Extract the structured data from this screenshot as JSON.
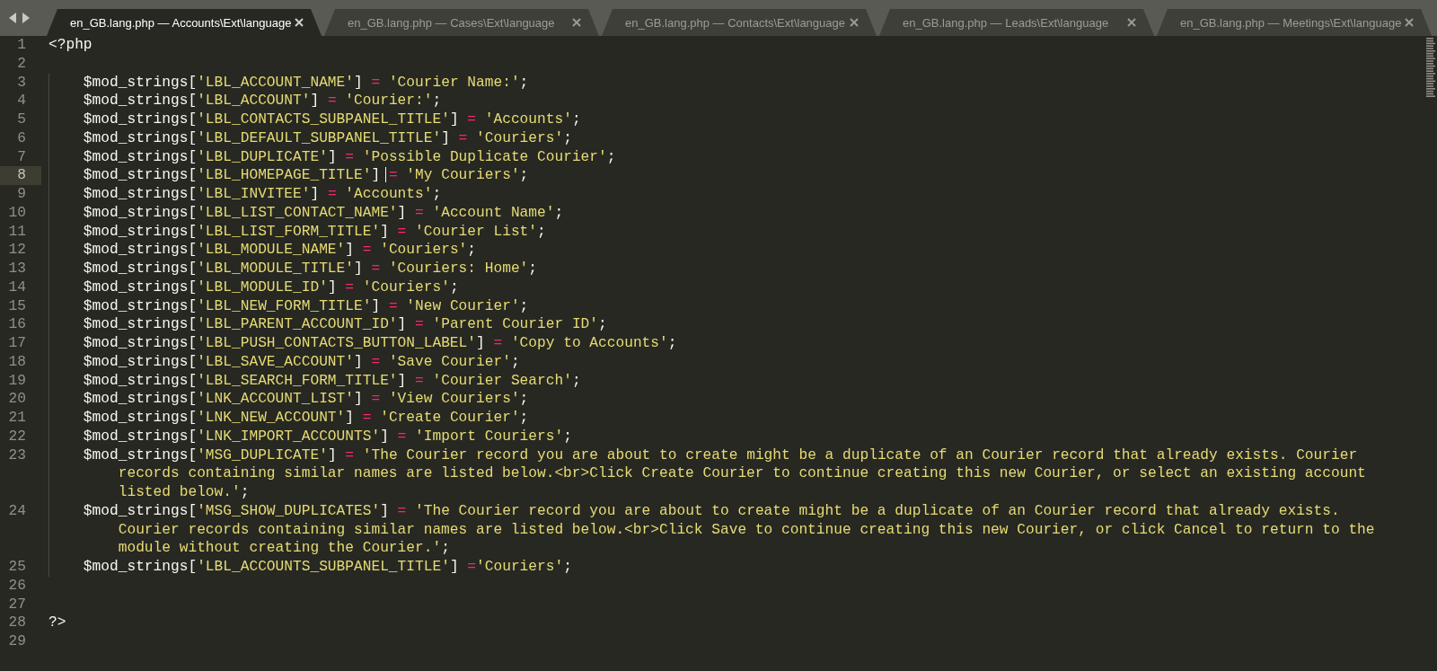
{
  "tabs": [
    {
      "label": "en_GB.lang.php — Accounts\\Ext\\language",
      "selected": true
    },
    {
      "label": "en_GB.lang.php — Cases\\Ext\\language",
      "selected": false
    },
    {
      "label": "en_GB.lang.php — Contacts\\Ext\\language",
      "selected": false
    },
    {
      "label": "en_GB.lang.php — Leads\\Ext\\language",
      "selected": false
    },
    {
      "label": "en_GB.lang.php — Meetings\\Ext\\language",
      "selected": false
    }
  ],
  "lines": [
    {
      "number": "1",
      "current": false,
      "indented": false,
      "tokens": [
        {
          "kind": "plain",
          "text": "<?php"
        }
      ]
    },
    {
      "number": "2",
      "current": false
    },
    {
      "number": "3",
      "current": false,
      "indented": true,
      "tokens": [
        {
          "kind": "plain",
          "text": "$mod_strings["
        },
        {
          "kind": "string",
          "text": "'LBL_ACCOUNT_NAME'"
        },
        {
          "kind": "plain",
          "text": "] "
        },
        {
          "kind": "op",
          "text": "="
        },
        {
          "kind": "string",
          "text": " 'Courier Name:'"
        },
        {
          "kind": "plain",
          "text": ";"
        }
      ]
    },
    {
      "number": "4",
      "current": false,
      "indented": true,
      "tokens": [
        {
          "kind": "plain",
          "text": "$mod_strings["
        },
        {
          "kind": "string",
          "text": "'LBL_ACCOUNT'"
        },
        {
          "kind": "plain",
          "text": "] "
        },
        {
          "kind": "op",
          "text": "="
        },
        {
          "kind": "string",
          "text": " 'Courier:'"
        },
        {
          "kind": "plain",
          "text": ";"
        }
      ]
    },
    {
      "number": "5",
      "current": false,
      "indented": true,
      "tokens": [
        {
          "kind": "plain",
          "text": "$mod_strings["
        },
        {
          "kind": "string",
          "text": "'LBL_CONTACTS_SUBPANEL_TITLE'"
        },
        {
          "kind": "plain",
          "text": "] "
        },
        {
          "kind": "op",
          "text": "="
        },
        {
          "kind": "string",
          "text": " 'Accounts'"
        },
        {
          "kind": "plain",
          "text": ";"
        }
      ]
    },
    {
      "number": "6",
      "current": false,
      "indented": true,
      "tokens": [
        {
          "kind": "plain",
          "text": "$mod_strings["
        },
        {
          "kind": "string",
          "text": "'LBL_DEFAULT_SUBPANEL_TITLE'"
        },
        {
          "kind": "plain",
          "text": "] "
        },
        {
          "kind": "op",
          "text": "="
        },
        {
          "kind": "string",
          "text": " 'Couriers'"
        },
        {
          "kind": "plain",
          "text": ";"
        }
      ]
    },
    {
      "number": "7",
      "current": false,
      "indented": true,
      "tokens": [
        {
          "kind": "plain",
          "text": "$mod_strings["
        },
        {
          "kind": "string",
          "text": "'LBL_DUPLICATE'"
        },
        {
          "kind": "plain",
          "text": "] "
        },
        {
          "kind": "op",
          "text": "="
        },
        {
          "kind": "string",
          "text": " 'Possible Duplicate Courier'"
        },
        {
          "kind": "plain",
          "text": ";"
        }
      ]
    },
    {
      "number": "8",
      "current": true,
      "indented": true,
      "tokens": [
        {
          "kind": "plain",
          "text": "$mod_strings["
        },
        {
          "kind": "string",
          "text": "'LBL_HOMEPAGE_TITLE'"
        },
        {
          "kind": "plain",
          "text": "] ",
          "caret": true
        },
        {
          "kind": "op",
          "text": "="
        },
        {
          "kind": "string",
          "text": " 'My Couriers'"
        },
        {
          "kind": "plain",
          "text": ";"
        }
      ]
    },
    {
      "number": "9",
      "current": false,
      "indented": true,
      "tokens": [
        {
          "kind": "plain",
          "text": "$mod_strings["
        },
        {
          "kind": "string",
          "text": "'LBL_INVITEE'"
        },
        {
          "kind": "plain",
          "text": "] "
        },
        {
          "kind": "op",
          "text": "="
        },
        {
          "kind": "string",
          "text": " 'Accounts'"
        },
        {
          "kind": "plain",
          "text": ";"
        }
      ]
    },
    {
      "number": "10",
      "current": false,
      "indented": true,
      "tokens": [
        {
          "kind": "plain",
          "text": "$mod_strings["
        },
        {
          "kind": "string",
          "text": "'LBL_LIST_CONTACT_NAME'"
        },
        {
          "kind": "plain",
          "text": "] "
        },
        {
          "kind": "op",
          "text": "="
        },
        {
          "kind": "string",
          "text": " 'Account Name'"
        },
        {
          "kind": "plain",
          "text": ";"
        }
      ]
    },
    {
      "number": "11",
      "current": false,
      "indented": true,
      "tokens": [
        {
          "kind": "plain",
          "text": "$mod_strings["
        },
        {
          "kind": "string",
          "text": "'LBL_LIST_FORM_TITLE'"
        },
        {
          "kind": "plain",
          "text": "] "
        },
        {
          "kind": "op",
          "text": "="
        },
        {
          "kind": "string",
          "text": " 'Courier List'"
        },
        {
          "kind": "plain",
          "text": ";"
        }
      ]
    },
    {
      "number": "12",
      "current": false,
      "indented": true,
      "tokens": [
        {
          "kind": "plain",
          "text": "$mod_strings["
        },
        {
          "kind": "string",
          "text": "'LBL_MODULE_NAME'"
        },
        {
          "kind": "plain",
          "text": "] "
        },
        {
          "kind": "op",
          "text": "="
        },
        {
          "kind": "string",
          "text": " 'Couriers'"
        },
        {
          "kind": "plain",
          "text": ";"
        }
      ]
    },
    {
      "number": "13",
      "current": false,
      "indented": true,
      "tokens": [
        {
          "kind": "plain",
          "text": "$mod_strings["
        },
        {
          "kind": "string",
          "text": "'LBL_MODULE_TITLE'"
        },
        {
          "kind": "plain",
          "text": "] "
        },
        {
          "kind": "op",
          "text": "="
        },
        {
          "kind": "string",
          "text": " 'Couriers: Home'"
        },
        {
          "kind": "plain",
          "text": ";"
        }
      ]
    },
    {
      "number": "14",
      "current": false,
      "indented": true,
      "tokens": [
        {
          "kind": "plain",
          "text": "$mod_strings["
        },
        {
          "kind": "string",
          "text": "'LBL_MODULE_ID'"
        },
        {
          "kind": "plain",
          "text": "] "
        },
        {
          "kind": "op",
          "text": "="
        },
        {
          "kind": "string",
          "text": " 'Couriers'"
        },
        {
          "kind": "plain",
          "text": ";"
        }
      ]
    },
    {
      "number": "15",
      "current": false,
      "indented": true,
      "tokens": [
        {
          "kind": "plain",
          "text": "$mod_strings["
        },
        {
          "kind": "string",
          "text": "'LBL_NEW_FORM_TITLE'"
        },
        {
          "kind": "plain",
          "text": "] "
        },
        {
          "kind": "op",
          "text": "="
        },
        {
          "kind": "string",
          "text": " 'New Courier'"
        },
        {
          "kind": "plain",
          "text": ";"
        }
      ]
    },
    {
      "number": "16",
      "current": false,
      "indented": true,
      "tokens": [
        {
          "kind": "plain",
          "text": "$mod_strings["
        },
        {
          "kind": "string",
          "text": "'LBL_PARENT_ACCOUNT_ID'"
        },
        {
          "kind": "plain",
          "text": "] "
        },
        {
          "kind": "op",
          "text": "="
        },
        {
          "kind": "string",
          "text": " 'Parent Courier ID'"
        },
        {
          "kind": "plain",
          "text": ";"
        }
      ]
    },
    {
      "number": "17",
      "current": false,
      "indented": true,
      "tokens": [
        {
          "kind": "plain",
          "text": "$mod_strings["
        },
        {
          "kind": "string",
          "text": "'LBL_PUSH_CONTACTS_BUTTON_LABEL'"
        },
        {
          "kind": "plain",
          "text": "] "
        },
        {
          "kind": "op",
          "text": "="
        },
        {
          "kind": "string",
          "text": " 'Copy to Accounts'"
        },
        {
          "kind": "plain",
          "text": ";"
        }
      ]
    },
    {
      "number": "18",
      "current": false,
      "indented": true,
      "tokens": [
        {
          "kind": "plain",
          "text": "$mod_strings["
        },
        {
          "kind": "string",
          "text": "'LBL_SAVE_ACCOUNT'"
        },
        {
          "kind": "plain",
          "text": "] "
        },
        {
          "kind": "op",
          "text": "="
        },
        {
          "kind": "string",
          "text": " 'Save Courier'"
        },
        {
          "kind": "plain",
          "text": ";"
        }
      ]
    },
    {
      "number": "19",
      "current": false,
      "indented": true,
      "tokens": [
        {
          "kind": "plain",
          "text": "$mod_strings["
        },
        {
          "kind": "string",
          "text": "'LBL_SEARCH_FORM_TITLE'"
        },
        {
          "kind": "plain",
          "text": "] "
        },
        {
          "kind": "op",
          "text": "="
        },
        {
          "kind": "string",
          "text": " 'Courier Search'"
        },
        {
          "kind": "plain",
          "text": ";"
        }
      ]
    },
    {
      "number": "20",
      "current": false,
      "indented": true,
      "tokens": [
        {
          "kind": "plain",
          "text": "$mod_strings["
        },
        {
          "kind": "string",
          "text": "'LNK_ACCOUNT_LIST'"
        },
        {
          "kind": "plain",
          "text": "] "
        },
        {
          "kind": "op",
          "text": "="
        },
        {
          "kind": "string",
          "text": " 'View Couriers'"
        },
        {
          "kind": "plain",
          "text": ";"
        }
      ]
    },
    {
      "number": "21",
      "current": false,
      "indented": true,
      "tokens": [
        {
          "kind": "plain",
          "text": "$mod_strings["
        },
        {
          "kind": "string",
          "text": "'LNK_NEW_ACCOUNT'"
        },
        {
          "kind": "plain",
          "text": "] "
        },
        {
          "kind": "op",
          "text": "="
        },
        {
          "kind": "string",
          "text": " 'Create Courier'"
        },
        {
          "kind": "plain",
          "text": ";"
        }
      ]
    },
    {
      "number": "22",
      "current": false,
      "indented": true,
      "tokens": [
        {
          "kind": "plain",
          "text": "$mod_strings["
        },
        {
          "kind": "string",
          "text": "'LNK_IMPORT_ACCOUNTS'"
        },
        {
          "kind": "plain",
          "text": "] "
        },
        {
          "kind": "op",
          "text": "="
        },
        {
          "kind": "string",
          "text": " 'Import Couriers'"
        },
        {
          "kind": "plain",
          "text": ";"
        }
      ]
    },
    {
      "number": "23",
      "current": false,
      "indented": true,
      "tokens": [
        {
          "kind": "plain",
          "text": "$mod_strings["
        },
        {
          "kind": "string",
          "text": "'MSG_DUPLICATE'"
        },
        {
          "kind": "plain",
          "text": "] "
        },
        {
          "kind": "op",
          "text": "="
        },
        {
          "kind": "string",
          "text": " 'The Courier record you are about to create might be a duplicate of an Courier record that already exists. Courier records containing similar names are listed below.<br>Click Create Courier to continue creating this new Courier, or select an existing account listed below.'"
        },
        {
          "kind": "plain",
          "text": ";"
        }
      ]
    },
    {
      "number": "24",
      "current": false,
      "indented": true,
      "tokens": [
        {
          "kind": "plain",
          "text": "$mod_strings["
        },
        {
          "kind": "string",
          "text": "'MSG_SHOW_DUPLICATES'"
        },
        {
          "kind": "plain",
          "text": "] "
        },
        {
          "kind": "op",
          "text": "="
        },
        {
          "kind": "string",
          "text": " 'The Courier record you are about to create might be a duplicate of an Courier record that already exists. Courier records containing similar names are listed below.<br>Click Save to continue creating this new Courier, or click Cancel to return to the module without creating the Courier.'"
        },
        {
          "kind": "plain",
          "text": ";"
        }
      ]
    },
    {
      "number": "25",
      "current": false,
      "indented": true,
      "tokens": [
        {
          "kind": "plain",
          "text": "$mod_strings["
        },
        {
          "kind": "string",
          "text": "'LBL_ACCOUNTS_SUBPANEL_TITLE'"
        },
        {
          "kind": "plain",
          "text": "] "
        },
        {
          "kind": "op",
          "text": "="
        },
        {
          "kind": "string",
          "text": "'Couriers'"
        },
        {
          "kind": "plain",
          "text": ";"
        }
      ]
    },
    {
      "number": "26",
      "current": false
    },
    {
      "number": "27",
      "current": false
    },
    {
      "number": "28",
      "current": false,
      "indented": false,
      "tokens": [
        {
          "kind": "plain",
          "text": "?>"
        }
      ]
    },
    {
      "number": "29",
      "current": false
    }
  ]
}
